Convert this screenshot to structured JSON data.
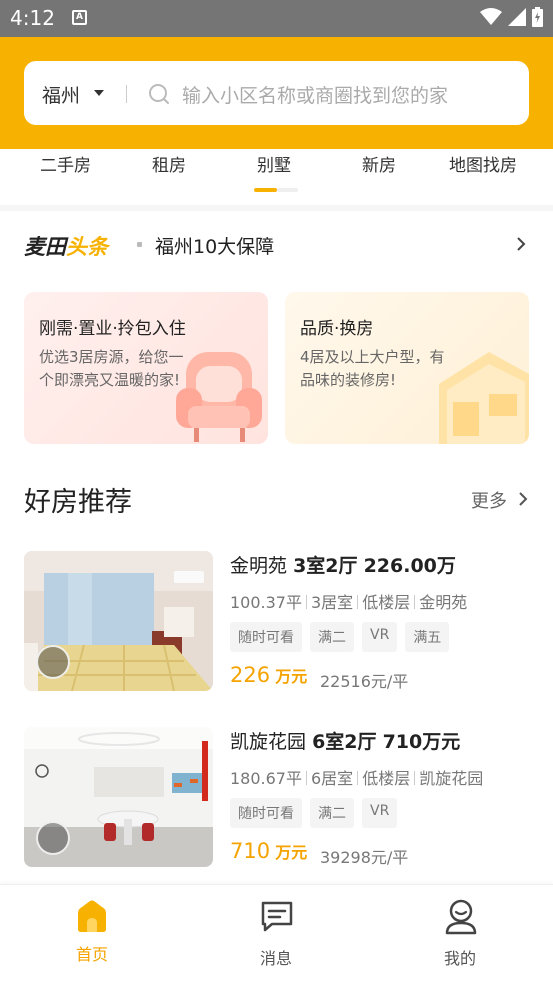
{
  "status_bar": {
    "time": "4:12",
    "notif_letter": "A"
  },
  "search": {
    "city": "福州",
    "placeholder": "输入小区名称或商圈找到您的家"
  },
  "tabs": [
    {
      "label": "二手房"
    },
    {
      "label": "租房"
    },
    {
      "label": "别墅"
    },
    {
      "label": "新房"
    },
    {
      "label": "地图找房"
    }
  ],
  "news": {
    "logo_part1": "麦田",
    "logo_part2": "头条",
    "text": "福州10大保障"
  },
  "cards": [
    {
      "title": "刚需·置业·拎包入住",
      "desc": "优选3居房源，给您一个即漂亮又温暖的家!"
    },
    {
      "title": "品质·换房",
      "desc": "4居及以上大户型，有品味的装修房!"
    }
  ],
  "section": {
    "title": "好房推荐",
    "more": "更多"
  },
  "listings": [
    {
      "name": "金明苑",
      "layout": "3室2厅",
      "total": "226.00万",
      "area": "100.37平",
      "rooms": "3居室",
      "floor": "低楼层",
      "community": "金明苑",
      "tags": [
        "随时可看",
        "满二",
        "VR",
        "满五"
      ],
      "price_num": "226",
      "price_unit": "万元",
      "unit_price": "22516元/平"
    },
    {
      "name": "凯旋花园",
      "layout": "6室2厅",
      "total": "710万元",
      "area": "180.67平",
      "rooms": "6居室",
      "floor": "低楼层",
      "community": "凯旋花园",
      "tags": [
        "随时可看",
        "满二",
        "VR"
      ],
      "price_num": "710",
      "price_unit": "万元",
      "unit_price": "39298元/平"
    }
  ],
  "bottom_nav": [
    {
      "label": "首页",
      "icon": "home-icon",
      "active": true
    },
    {
      "label": "消息",
      "icon": "message-icon",
      "active": false
    },
    {
      "label": "我的",
      "icon": "profile-icon",
      "active": false
    }
  ],
  "colors": {
    "accent": "#f7b100",
    "price": "#f5a300"
  }
}
